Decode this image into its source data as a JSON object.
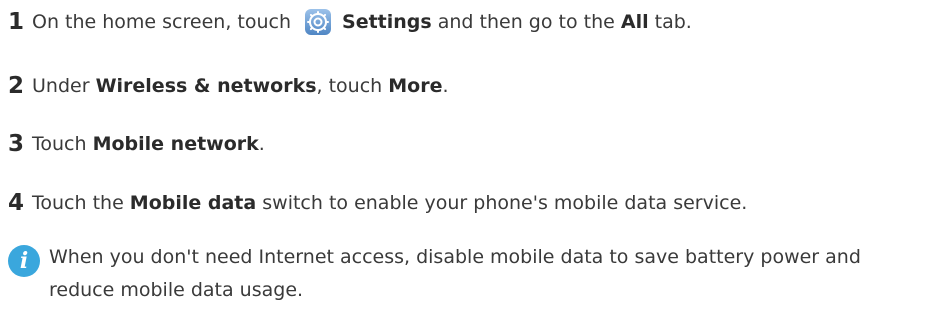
{
  "steps": [
    {
      "number": "1",
      "parts": {
        "a": "On the home screen, touch",
        "b": "Settings",
        "c": " and then go to the ",
        "d": "All",
        "e": " tab."
      }
    },
    {
      "number": "2",
      "parts": {
        "a": "Under ",
        "b": "Wireless & networks",
        "c": ", touch ",
        "d": "More",
        "e": "."
      }
    },
    {
      "number": "3",
      "parts": {
        "a": "Touch ",
        "b": "Mobile network",
        "c": "."
      }
    },
    {
      "number": "4",
      "parts": {
        "a": "Touch the ",
        "b": "Mobile data",
        "c": " switch to enable your phone's mobile data service."
      }
    }
  ],
  "note": {
    "icon": "info-icon",
    "icon_glyph": "i",
    "line1": "When you don't need Internet access, disable mobile data to save battery power and",
    "line2": "reduce mobile data usage."
  },
  "icons": {
    "settings": "settings-gear-icon"
  },
  "colors": {
    "info_icon": "#3aa7dd",
    "settings_icon_bg": "#7aa8d6",
    "text": "#3a3a3a"
  }
}
